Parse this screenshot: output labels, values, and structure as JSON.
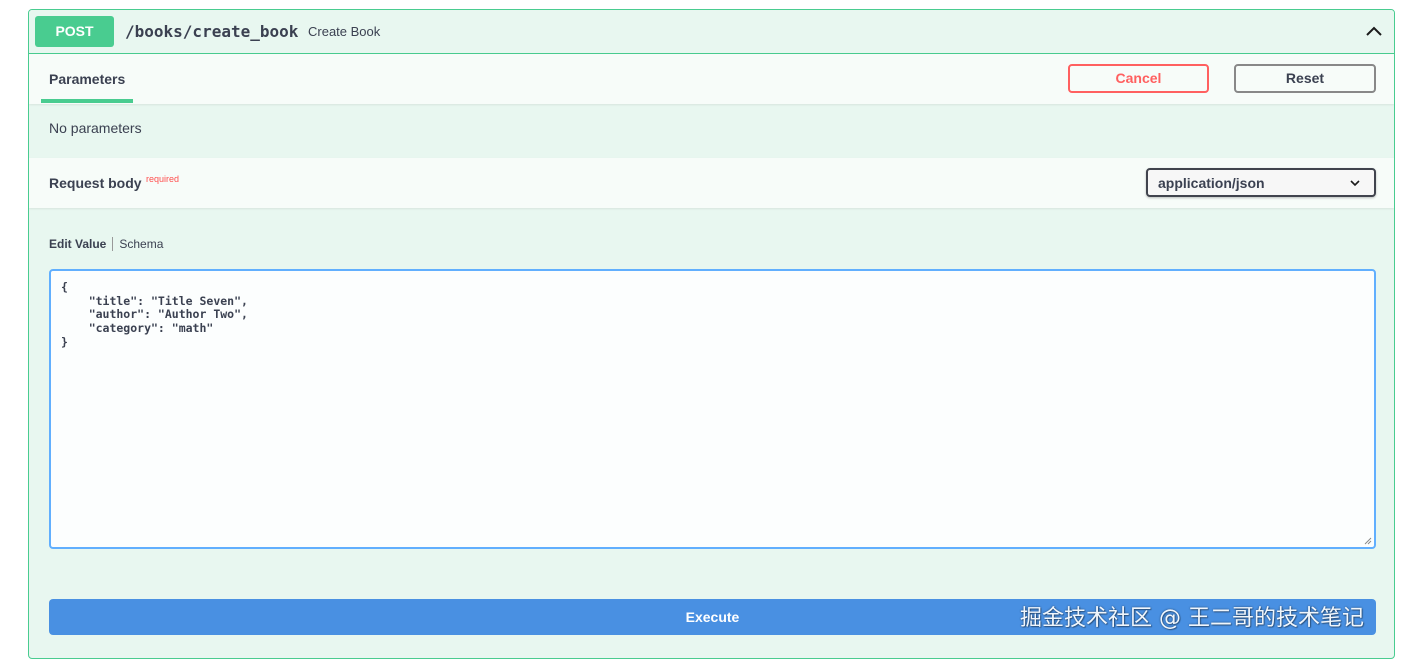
{
  "operation": {
    "method": "POST",
    "path": "/books/create_book",
    "summary": "Create Book"
  },
  "parameters": {
    "tab_label": "Parameters",
    "cancel_label": "Cancel",
    "reset_label": "Reset",
    "empty_text": "No parameters"
  },
  "request_body": {
    "title": "Request body",
    "required_label": "required",
    "content_type": "application/json",
    "tabs": [
      "Edit Value",
      "Schema"
    ],
    "value": "{\n    \"title\": \"Title Seven\",\n    \"author\": \"Author Two\",\n    \"category\": \"math\"\n}"
  },
  "execute_label": "Execute",
  "watermark": "掘金技术社区 @ 王二哥的技术笔记",
  "icons": {
    "collapse": "chevron-up-icon",
    "select": "chevron-down-icon"
  },
  "colors": {
    "post": "#49cc90",
    "cancel": "#ff6060",
    "execute": "#4990e2",
    "editor_border": "#61affe"
  }
}
